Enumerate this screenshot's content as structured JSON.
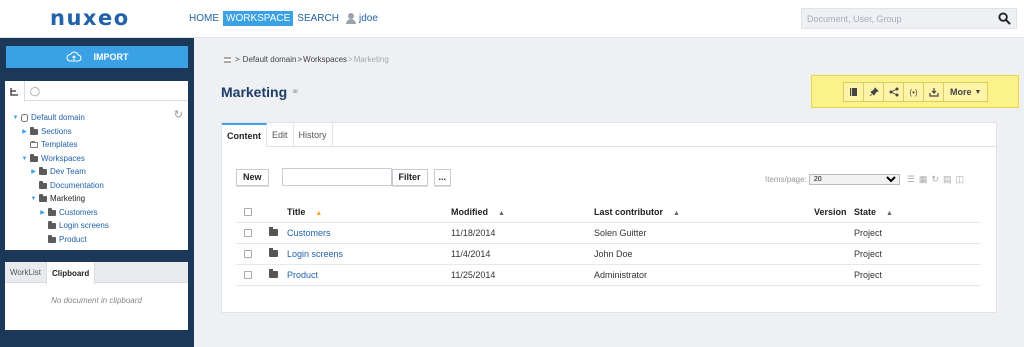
{
  "header": {
    "logo": "nuxeo",
    "nav": [
      {
        "label": "HOME",
        "active": false
      },
      {
        "label": "WORKSPACE",
        "active": true
      },
      {
        "label": "SEARCH",
        "active": false
      }
    ],
    "user": "jdoe",
    "search_placeholder": "Document, User, Group"
  },
  "sidebar": {
    "import_label": "IMPORT",
    "tree": [
      {
        "label": "Default domain",
        "icon": "database-icon",
        "arrow": "down"
      },
      {
        "label": "Sections",
        "icon": "folder-icon",
        "arrow": "right"
      },
      {
        "label": "Templates",
        "icon": "folder-light-icon",
        "arrow": ""
      },
      {
        "label": "Workspaces",
        "icon": "folder-icon",
        "arrow": "down"
      },
      {
        "label": "Dev Team",
        "icon": "folder-icon",
        "arrow": "right"
      },
      {
        "label": "Documentation",
        "icon": "folder-icon",
        "arrow": ""
      },
      {
        "label": "Marketing",
        "icon": "folder-icon",
        "arrow": "down",
        "selected": true
      },
      {
        "label": "Customers",
        "icon": "folder-icon",
        "arrow": "right"
      },
      {
        "label": "Login screens",
        "icon": "folder-icon",
        "arrow": ""
      },
      {
        "label": "Product",
        "icon": "folder-icon",
        "arrow": ""
      }
    ],
    "clip_tabs": [
      "WorkList",
      "Clipboard"
    ],
    "clip_empty": "No document in clipboard"
  },
  "breadcrumb": {
    "items": [
      "Default domain",
      "Workspaces"
    ],
    "current": "Marketing"
  },
  "page_title": "Marketing",
  "actions": {
    "more_label": "More"
  },
  "tabs": [
    "Content",
    "Edit",
    "History"
  ],
  "toolbar": {
    "new_label": "New",
    "filter_label": "Filter",
    "dots_label": "...",
    "items_per_page_label": "Items/page",
    "items_per_page_value": "20"
  },
  "table": {
    "headers": {
      "title": "Title",
      "modified": "Modified",
      "contributor": "Last contributor",
      "version": "Version",
      "state": "State"
    },
    "rows": [
      {
        "title": "Customers",
        "modified": "11/18/2014",
        "contributor": "Solen Guitter",
        "version": "",
        "state": "Project"
      },
      {
        "title": "Login screens",
        "modified": "11/4/2014",
        "contributor": "John Doe",
        "version": "",
        "state": "Project"
      },
      {
        "title": "Product",
        "modified": "11/25/2014",
        "contributor": "Administrator",
        "version": "",
        "state": "Project"
      }
    ]
  },
  "colors": {
    "accent": "#3aa1e5",
    "sidebar": "#1b3858",
    "highlight": "#fbf38a",
    "link": "#2262a8"
  }
}
